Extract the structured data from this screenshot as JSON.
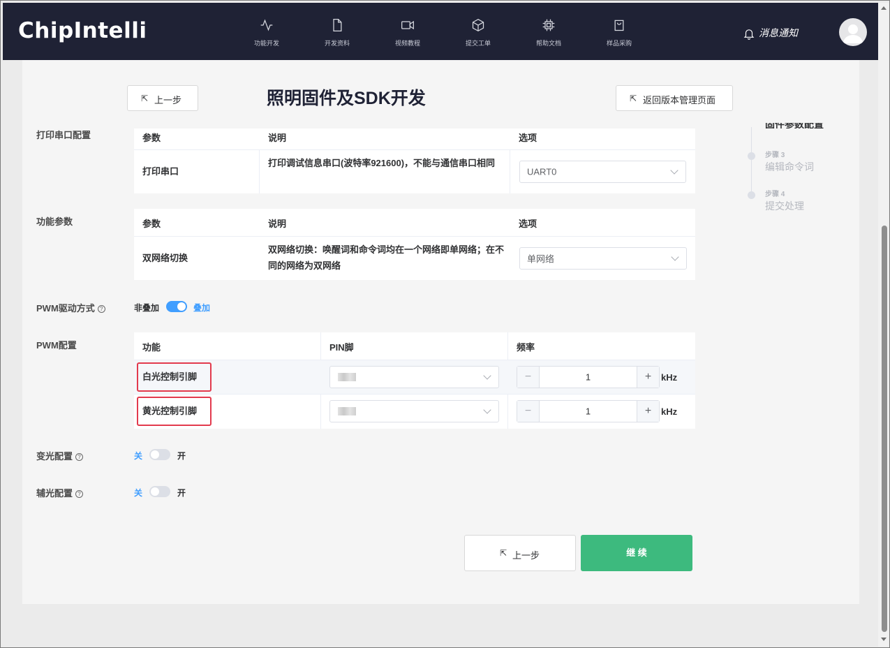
{
  "header": {
    "logo": "ChipIntelli",
    "nav": [
      {
        "label": "功能开发",
        "icon": "activity-icon"
      },
      {
        "label": "开发资料",
        "icon": "file-icon"
      },
      {
        "label": "视频教程",
        "icon": "video-icon"
      },
      {
        "label": "提交工单",
        "icon": "box-icon"
      },
      {
        "label": "帮助文档",
        "icon": "chip-icon"
      },
      {
        "label": "样品采购",
        "icon": "shopping-bag-icon"
      }
    ],
    "notice_label": "消息通知"
  },
  "page": {
    "title": "照明固件及SDK开发",
    "back_label": "上一步",
    "return_label": "返回版本管理页面"
  },
  "serial_config": {
    "section_label": "打印串口配置",
    "headers": {
      "param": "参数",
      "desc": "说明",
      "option": "选项"
    },
    "row": {
      "param": "打印串口",
      "desc": "打印调试信息串口(波特率921600)，不能与通信串口相同",
      "option": "UART0"
    }
  },
  "function_params": {
    "section_label": "功能参数",
    "headers": {
      "param": "参数",
      "desc": "说明",
      "option": "选项"
    },
    "row": {
      "param": "双网络切换",
      "desc": "双网络切换：唤醒词和命令词均在一个网络即单网络；在不同的网络为双网络",
      "option": "单网络"
    }
  },
  "pwm_mode": {
    "section_label": "PWM驱动方式",
    "off_label": "非叠加",
    "on_label": "叠加",
    "enabled": true,
    "accent": "#409eff"
  },
  "pwm_config": {
    "section_label": "PWM配置",
    "headers": {
      "func": "功能",
      "pin": "PIN脚",
      "freq": "频率"
    },
    "rows": [
      {
        "func": "白光控制引脚",
        "freq": "1",
        "unit": "kHz"
      },
      {
        "func": "黄光控制引脚",
        "freq": "1",
        "unit": "kHz"
      }
    ],
    "highlight_color": "#e23a4d"
  },
  "dimming": {
    "section_label": "变光配置",
    "off_label": "关",
    "on_label": "开",
    "enabled": false
  },
  "aux_light": {
    "section_label": "辅光配置",
    "off_label": "关",
    "on_label": "开",
    "enabled": false
  },
  "steps": [
    {
      "title": "固件参数配置"
    },
    {
      "num": "步骤 3",
      "title": "编辑命令词"
    },
    {
      "num": "步骤 4",
      "title": "提交处理"
    }
  ],
  "footer": {
    "back_label": "上一步",
    "continue_label": "继 续",
    "continue_color": "#3dba7e"
  }
}
